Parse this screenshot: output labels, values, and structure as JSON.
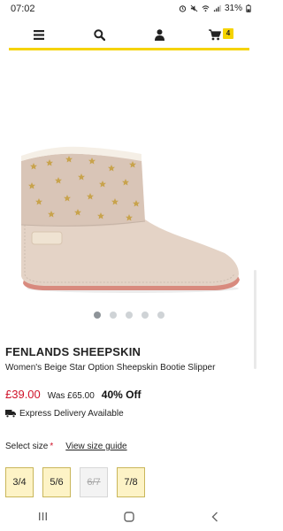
{
  "status": {
    "time": "07:02",
    "battery": "31%",
    "icons": [
      "alarm-icon",
      "mute-icon",
      "wifi-icon",
      "signal-icon",
      "battery-icon"
    ]
  },
  "nav": {
    "icons": [
      "menu-icon",
      "search-icon",
      "user-icon",
      "cart-icon"
    ],
    "cart_count": "4"
  },
  "gallery": {
    "slide_count": 5,
    "active_index": 0
  },
  "product": {
    "brand": "FENLANDS SHEEPSKIN",
    "name": "Women's Beige Star Option Sheepskin Bootie Slipper",
    "price_now": "£39.00",
    "price_was": "Was £65.00",
    "discount": "40% Off",
    "delivery": "Express Delivery Available"
  },
  "size": {
    "label": "Select size",
    "required_mark": "*",
    "guide_link": "View size guide",
    "options": [
      {
        "label": "3/4",
        "available": true
      },
      {
        "label": "5/6",
        "available": true
      },
      {
        "label": "6/7",
        "available": false
      },
      {
        "label": "7/8",
        "available": true
      }
    ]
  },
  "colors": {
    "accent": "#f5d300",
    "price_red": "#d0132a"
  }
}
